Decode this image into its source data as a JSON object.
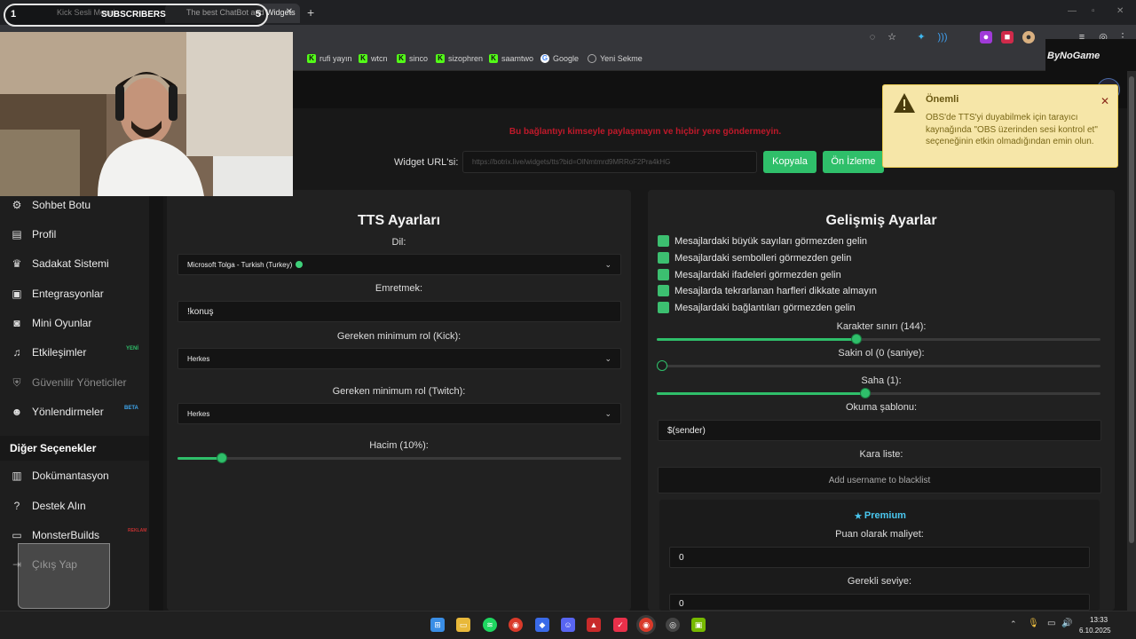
{
  "browser": {
    "tabs": [
      {
        "label": "Kick Sesli Mesaj"
      },
      {
        "label": "The best ChatBot and Widgets"
      }
    ],
    "bookmarks": [
      {
        "label": "rufi yayın",
        "icon": "kick"
      },
      {
        "label": "wtcn",
        "icon": "kick"
      },
      {
        "label": "sinco",
        "icon": "kick"
      },
      {
        "label": "sizophren",
        "icon": "kick"
      },
      {
        "label": "saamtwo",
        "icon": "kick"
      },
      {
        "label": "Google",
        "icon": "google"
      },
      {
        "label": "Yeni Sekme",
        "icon": "globe"
      }
    ]
  },
  "overlay": {
    "subs_left": "1",
    "subs_label": "SUBSCRIBERS",
    "subs_right": "5",
    "brand": "ByNoGame"
  },
  "header": {
    "warning": "Bu bağlantıyı kimseyle paylaşmayın ve hiçbir yere göndermeyin.",
    "url_label": "Widget URL'si:",
    "url_value": "https://botrix.live/widgets/tts?bid=OlNmtmrd9MRRoF2Pra4kHG",
    "copy_button": "Kopyala",
    "preview_button": "Ön İzleme"
  },
  "notification": {
    "title": "Önemli",
    "body": "OBS'de TTS'yi duyabilmek için tarayıcı kaynağında \"OBS üzerinden sesi kontrol et\" seçeneğinin etkin olmadığından emin olun."
  },
  "sidebar": {
    "items": [
      {
        "label": "Sohbet Botu",
        "icon": "robot-icon"
      },
      {
        "label": "Profil",
        "icon": "id-card-icon"
      },
      {
        "label": "Sadakat Sistemi",
        "icon": "trophy-icon"
      },
      {
        "label": "Entegrasyonlar",
        "icon": "plug-icon"
      },
      {
        "label": "Mini Oyunlar",
        "icon": "gamepad-icon"
      },
      {
        "label": "Etkileşimler",
        "icon": "music-icon",
        "badge": "YENİ"
      },
      {
        "label": "Güvenilir Yöneticiler",
        "icon": "shield-icon"
      },
      {
        "label": "Yönlendirmeler",
        "icon": "users-icon",
        "badge": "BETA"
      }
    ],
    "section_title": "Diğer Seçenekler",
    "other_items": [
      {
        "label": "Dokümantasyon",
        "icon": "book-icon"
      },
      {
        "label": "Destek Alın",
        "icon": "help-icon"
      },
      {
        "label": "MonsterBuilds",
        "icon": "laptop-icon",
        "badge": "REKLAM"
      },
      {
        "label": "Çıkış Yap",
        "icon": "logout-icon"
      }
    ]
  },
  "tts": {
    "title": "TTS Ayarları",
    "language_label": "Dil:",
    "language_value": "Microsoft Tolga - Turkish (Turkey)",
    "command_label": "Emretmek:",
    "command_value": "!konuş",
    "kick_role_label": "Gereken minimum rol (Kick):",
    "kick_role_value": "Herkes",
    "twitch_role_label": "Gereken minimum rol (Twitch):",
    "twitch_role_value": "Herkes",
    "volume_label": "Hacim (10%):",
    "volume_fraction": 0.1
  },
  "advanced": {
    "title": "Gelişmiş Ayarlar",
    "checkboxes": [
      "Mesajlardaki büyük sayıları görmezden gelin",
      "Mesajlardaki sembolleri görmezden gelin",
      "Mesajlardaki ifadeleri görmezden gelin",
      "Mesajlarda tekrarlanan harfleri dikkate almayın",
      "Mesajlardaki bağlantıları görmezden gelin"
    ],
    "char_limit_label": "Karakter sınırı (144):",
    "char_limit_fraction": 0.45,
    "cooldown_label": "Sakin ol (0 (saniye):",
    "cooldown_fraction": 0,
    "pitch_label": "Saha (1):",
    "pitch_fraction": 0.47,
    "template_label": "Okuma şablonu:",
    "template_value": "$(sender)",
    "blacklist_label": "Kara liste:",
    "blacklist_placeholder": "Add username to blacklist",
    "premium_title": "Premium",
    "cost_label": "Puan olarak maliyet:",
    "cost_value": "0",
    "level_label": "Gerekli seviye:",
    "level_value": "0"
  },
  "taskbar": {
    "time": "13:33",
    "date": "6.10.2025"
  }
}
